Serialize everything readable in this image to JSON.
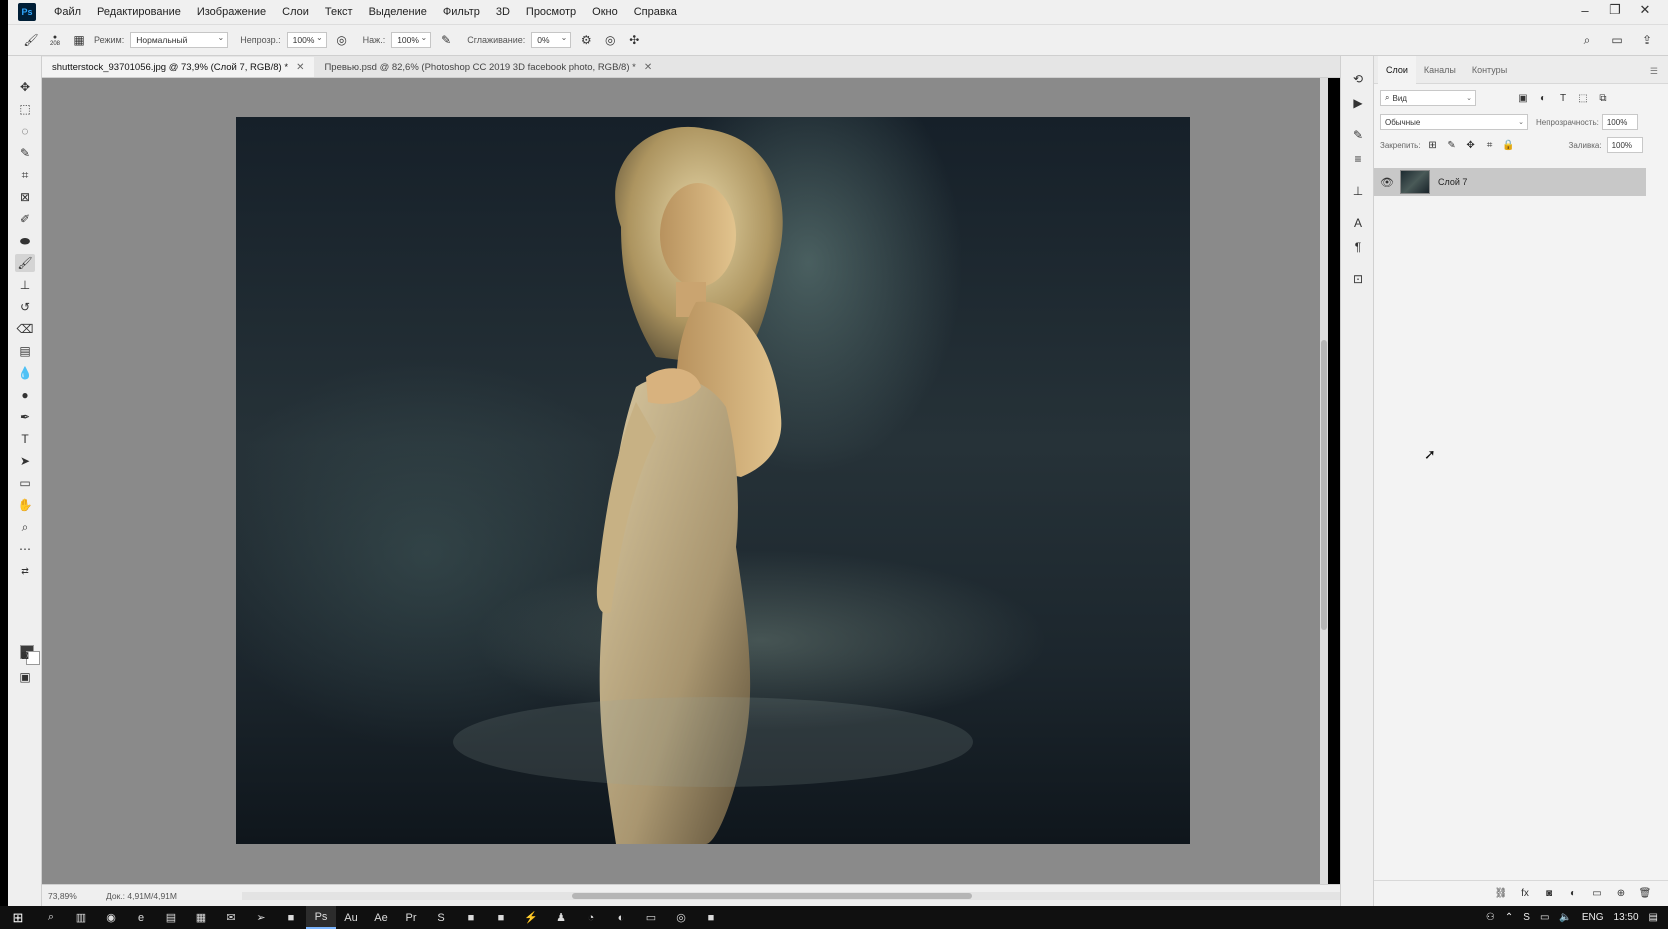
{
  "menu": [
    "Файл",
    "Редактирование",
    "Изображение",
    "Слои",
    "Текст",
    "Выделение",
    "Фильтр",
    "3D",
    "Просмотр",
    "Окно",
    "Справка"
  ],
  "app_logo": "Ps",
  "window_controls": [
    "–",
    "❐",
    "✕"
  ],
  "options": {
    "brush_size": "208",
    "mode_label": "Режим:",
    "mode_value": "Нормальный",
    "opacity_label": "Непрозр.:",
    "opacity_value": "100%",
    "flow_label": "Наж.:",
    "flow_value": "100%",
    "smoothing_label": "Сглаживание:",
    "smoothing_value": "0%"
  },
  "tabs": [
    {
      "label": "shutterstock_93701056.jpg @ 73,9% (Слой 7, RGB/8) *",
      "active": true
    },
    {
      "label": "Превью.psd @ 82,6% (Photoshop CC 2019  3D facebook photo, RGB/8) *",
      "active": false
    }
  ],
  "status": {
    "zoom": "73,89%",
    "doc": "Док.: 4,91M/4,91M"
  },
  "panel": {
    "tabs": [
      "Слои",
      "Каналы",
      "Контуры"
    ],
    "filter_value": "Вид",
    "blend_mode": "Обычные",
    "opacity_label": "Непрозрачность:",
    "opacity_value": "100%",
    "lock_label": "Закрепить:",
    "fill_label": "Заливка:",
    "fill_value": "100%",
    "layers": [
      {
        "name": "Слой 7",
        "visible": true,
        "selected": true
      }
    ]
  },
  "taskbar": {
    "lang": "ENG",
    "time": "13:50"
  },
  "colors": {
    "foreground": "#3c3c3c",
    "background": "#ffffff",
    "ps_brand": "#31a8ff"
  }
}
